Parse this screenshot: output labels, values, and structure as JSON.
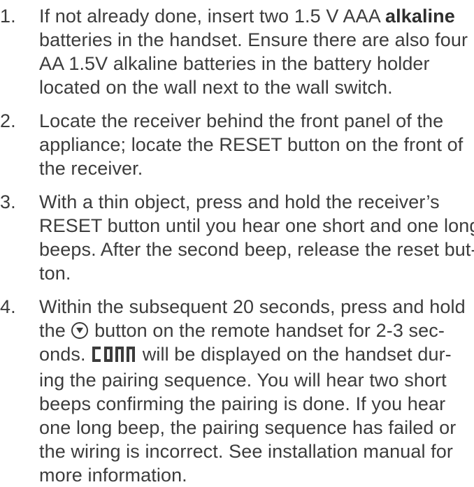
{
  "steps": [
    {
      "number": "1.",
      "lines": [
        {
          "pre": "If not already done, insert two 1.5 V AAA ",
          "bold": "alkaline"
        },
        {
          "text": "batteries in the handset. Ensure there are also four"
        },
        {
          "text": "AA 1.5V alkaline batteries in the battery holder"
        },
        {
          "text": "located on the wall next to the wall switch."
        }
      ]
    },
    {
      "number": "2.",
      "lines": [
        {
          "text": "Locate the receiver behind the front panel of the"
        },
        {
          "text": "appliance; locate the RESET button on the front of"
        },
        {
          "text": "the receiver."
        }
      ]
    },
    {
      "number": "3.",
      "lines": [
        {
          "text": "With a thin object, press and hold the receiver’s"
        },
        {
          "text": "RESET button until you hear one short and one long"
        },
        {
          "text": "beeps. After the second beep, release the reset but-"
        },
        {
          "text": "ton."
        }
      ]
    },
    {
      "number": "4.",
      "lines": [
        {
          "text": "Within the subsequent 20 seconds, press and hold"
        },
        {
          "pre": "the",
          "post": "button on the remote handset for 2-3 sec-"
        },
        {
          "pre": "onds.",
          "post": "will be displayed on the handset dur-"
        },
        {
          "text": "ing the pairing sequence. You will hear two short"
        },
        {
          "text": "beeps confirming the pairing is done. If you hear"
        },
        {
          "text": "one long beep, the pairing sequence has failed or"
        },
        {
          "text": "the wiring is incorrect. See installation manual for"
        },
        {
          "text": "more information."
        }
      ]
    }
  ],
  "icons": {
    "down_button": "circle-down-arrow-icon",
    "display_glyph": "conn-segment-display-icon"
  }
}
